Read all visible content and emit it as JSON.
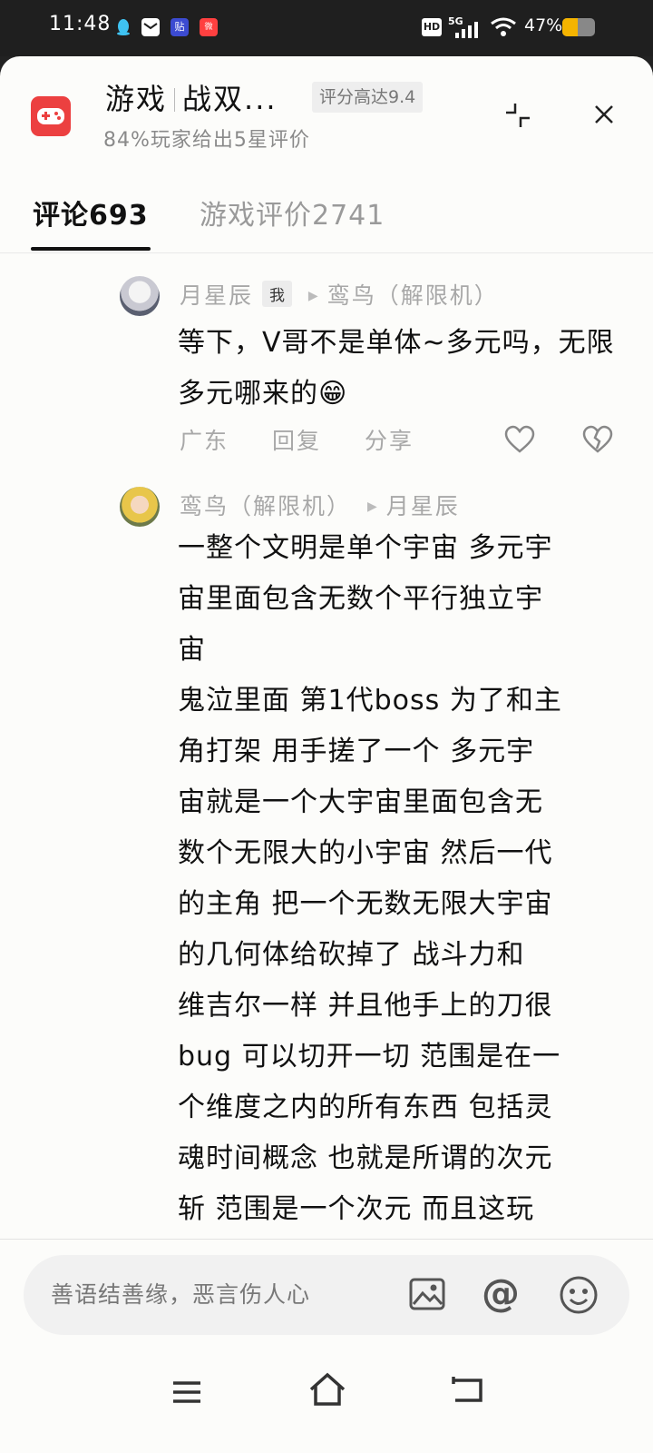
{
  "status_bar": {
    "time": "11:48",
    "network": "5G",
    "hd_label": "HD",
    "battery_text": "47%",
    "battery_level": 0.47,
    "app_icons": [
      "qq-icon",
      "mail-icon",
      "tieba-icon",
      "weibo-icon"
    ]
  },
  "header": {
    "app_label": "游戏",
    "game_name": "战双...",
    "rating_badge": "评分高达9.4",
    "subtitle": "84%玩家给出5星评价"
  },
  "tabs": [
    {
      "label": "评论693",
      "active": true
    },
    {
      "label": "游戏评价2741",
      "active": false
    }
  ],
  "comments": [
    {
      "author": "月星辰",
      "me_tag": "我",
      "reply_to": "鸾鸟（解限机）",
      "text": "等下，V哥不是单体~多元吗，无限多元哪来的😁",
      "location": "广东",
      "reply_label": "回复",
      "share_label": "分享"
    },
    {
      "author": "鸾鸟（解限机）",
      "reply_to": "月星辰",
      "text_lines": [
        "一整个文明是单个宇宙 多元宇",
        "宙里面包含无数个平行独立宇",
        "宙",
        "鬼泣里面 第1代boss 为了和主",
        "角打架 用手搓了一个 多元宇",
        "宙就是一个大宇宙里面包含无",
        "数个无限大的小宇宙 然后一代",
        "的主角 把一个无数无限大宇宙",
        "的几何体给砍掉了  战斗力和",
        "维吉尔一样 并且他手上的刀很",
        "bug 可以切开一切 范围是在一",
        "个维度之内的所有东西 包括灵",
        "魂时间概念 也就是所谓的次元",
        "斩 范围是一个次元 而且这玩"
      ]
    }
  ],
  "input": {
    "placeholder": "善语结善缘，恶言伤人心",
    "at_symbol": "@"
  },
  "colors": {
    "accent_red": "#ec4040",
    "battery_yellow": "#f5b400",
    "muted_text": "#a8a8a8"
  }
}
